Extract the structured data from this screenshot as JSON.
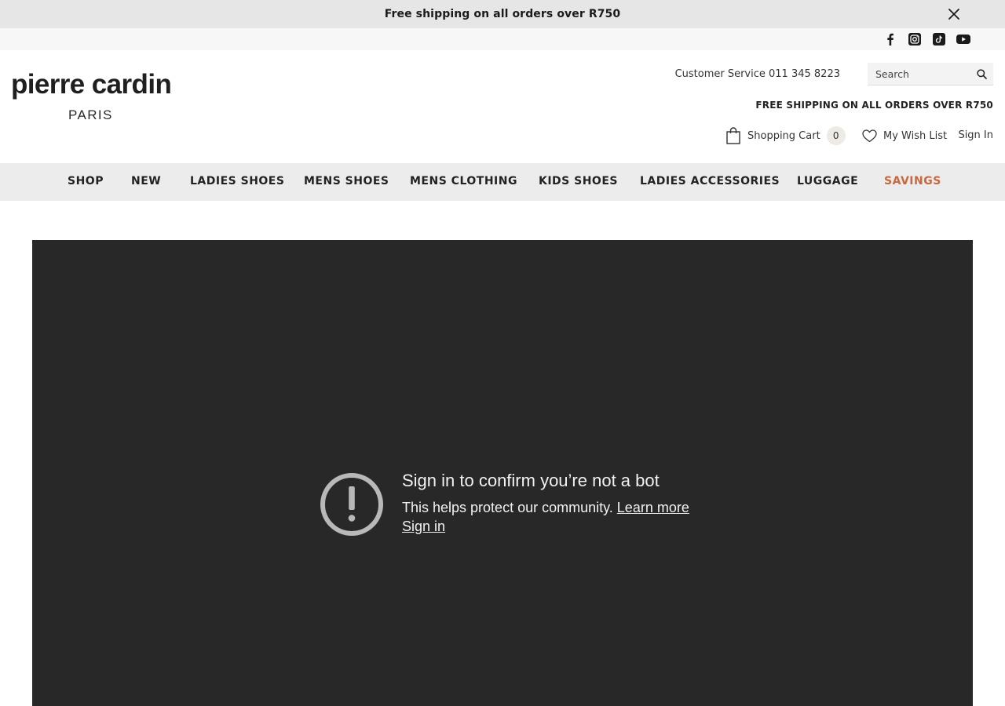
{
  "announcement": {
    "text": "Free shipping on all orders over R750",
    "close_icon": "close-icon"
  },
  "social": {
    "icons": [
      "facebook-icon",
      "instagram-icon",
      "tiktok-icon",
      "youtube-icon"
    ]
  },
  "header": {
    "logo_main": "pierre cardin",
    "logo_sub": "PARIS",
    "customer_service": "Customer Service 011 345 8223",
    "search_placeholder": "Search",
    "shipping_note": "FREE SHIPPING ON ALL ORDERS OVER R750",
    "cart_label": "Shopping Cart",
    "cart_count": "0",
    "wishlist_label": "My Wish List",
    "signin_label": "Sign In"
  },
  "nav": {
    "items": [
      {
        "label": "SHOP"
      },
      {
        "label": "NEW"
      },
      {
        "label": "LADIES SHOES"
      },
      {
        "label": "MENS SHOES"
      },
      {
        "label": "MENS CLOTHING"
      },
      {
        "label": "KIDS SHOES"
      },
      {
        "label": "LADIES ACCESSORIES"
      },
      {
        "label": "LUGGAGE"
      },
      {
        "label": "SAVINGS"
      }
    ],
    "highlight_color": "#c9673f"
  },
  "video": {
    "title": "Sign in to confirm you’re not a bot",
    "body": "This helps protect our community.",
    "learn_more": "Learn more",
    "sign_in": "Sign in",
    "background": "#282828"
  }
}
